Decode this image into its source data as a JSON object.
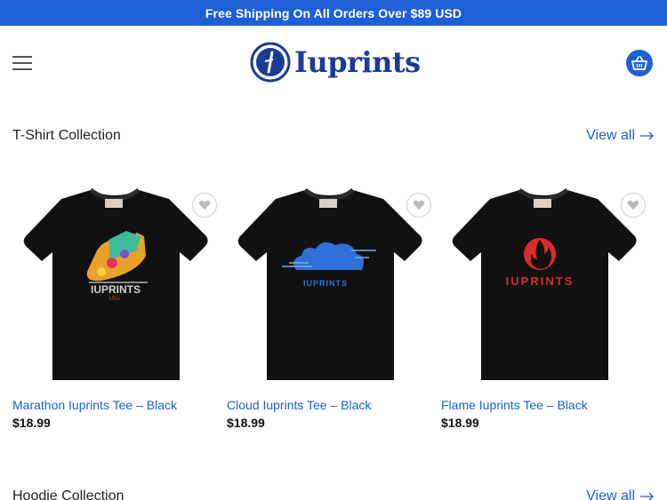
{
  "topbar": {
    "text": "Free Shipping On All Orders Over $89 USD"
  },
  "header": {
    "logo_text": "Iuprints",
    "brand_color": "#1e5fd6"
  },
  "sections": [
    {
      "title": "T-Shirt Collection",
      "view_all": "View all"
    },
    {
      "title": "Hoodie Collection",
      "view_all": "View all"
    }
  ],
  "products": [
    {
      "name": "Marathon Iuprints Tee – Black",
      "price": "$18.99",
      "print_text": "IUPRINTS",
      "print_sub": "USA"
    },
    {
      "name": "Cloud Iuprints Tee – Black",
      "price": "$18.99",
      "print_text": "IUPRINTS"
    },
    {
      "name": "Flame Iuprints Tee – Black",
      "price": "$18.99",
      "print_text": "IUPRINTS"
    }
  ]
}
